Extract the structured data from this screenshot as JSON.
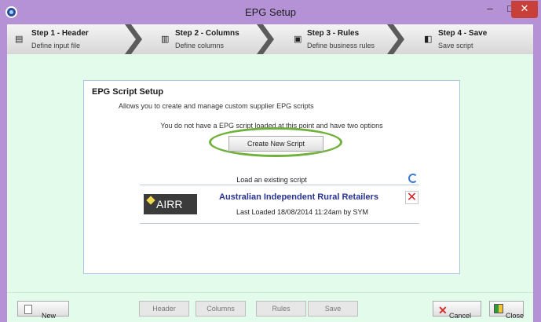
{
  "window": {
    "title": "EPG Setup",
    "controls": {
      "minimize_icon": "minimize-icon",
      "maximize_icon": "maximize-icon",
      "close_icon": "close-icon"
    },
    "accent_color": "#b592d6"
  },
  "steps": [
    {
      "title": "Step 1 - Header",
      "subtitle": "Define input file",
      "icon": "document-icon"
    },
    {
      "title": "Step 2 - Columns",
      "subtitle": "Define columns",
      "icon": "columns-icon"
    },
    {
      "title": "Step 3 - Rules",
      "subtitle": "Define business rules",
      "icon": "database-icon"
    },
    {
      "title": "Step 4 - Save",
      "subtitle": "Save script",
      "icon": "save-icon"
    }
  ],
  "panel": {
    "title": "EPG Script Setup",
    "description": "Allows you to create and manage custom supplier EPG scripts",
    "info": "You do not have a EPG script loaded at this point and have two options",
    "create_label": "Create New Script",
    "load_label": "Load an existing script",
    "script": {
      "logo_text": "AIRR",
      "name": "Australian Independent Rural Retailers",
      "last_loaded": "Last Loaded 18/08/2014 11:24am by SYM"
    }
  },
  "footer": {
    "new_label": "New",
    "header_label": "Header",
    "columns_label": "Columns",
    "rules_label": "Rules",
    "save_label": "Save",
    "cancel_label": "Cancel",
    "close_label": "Close"
  }
}
